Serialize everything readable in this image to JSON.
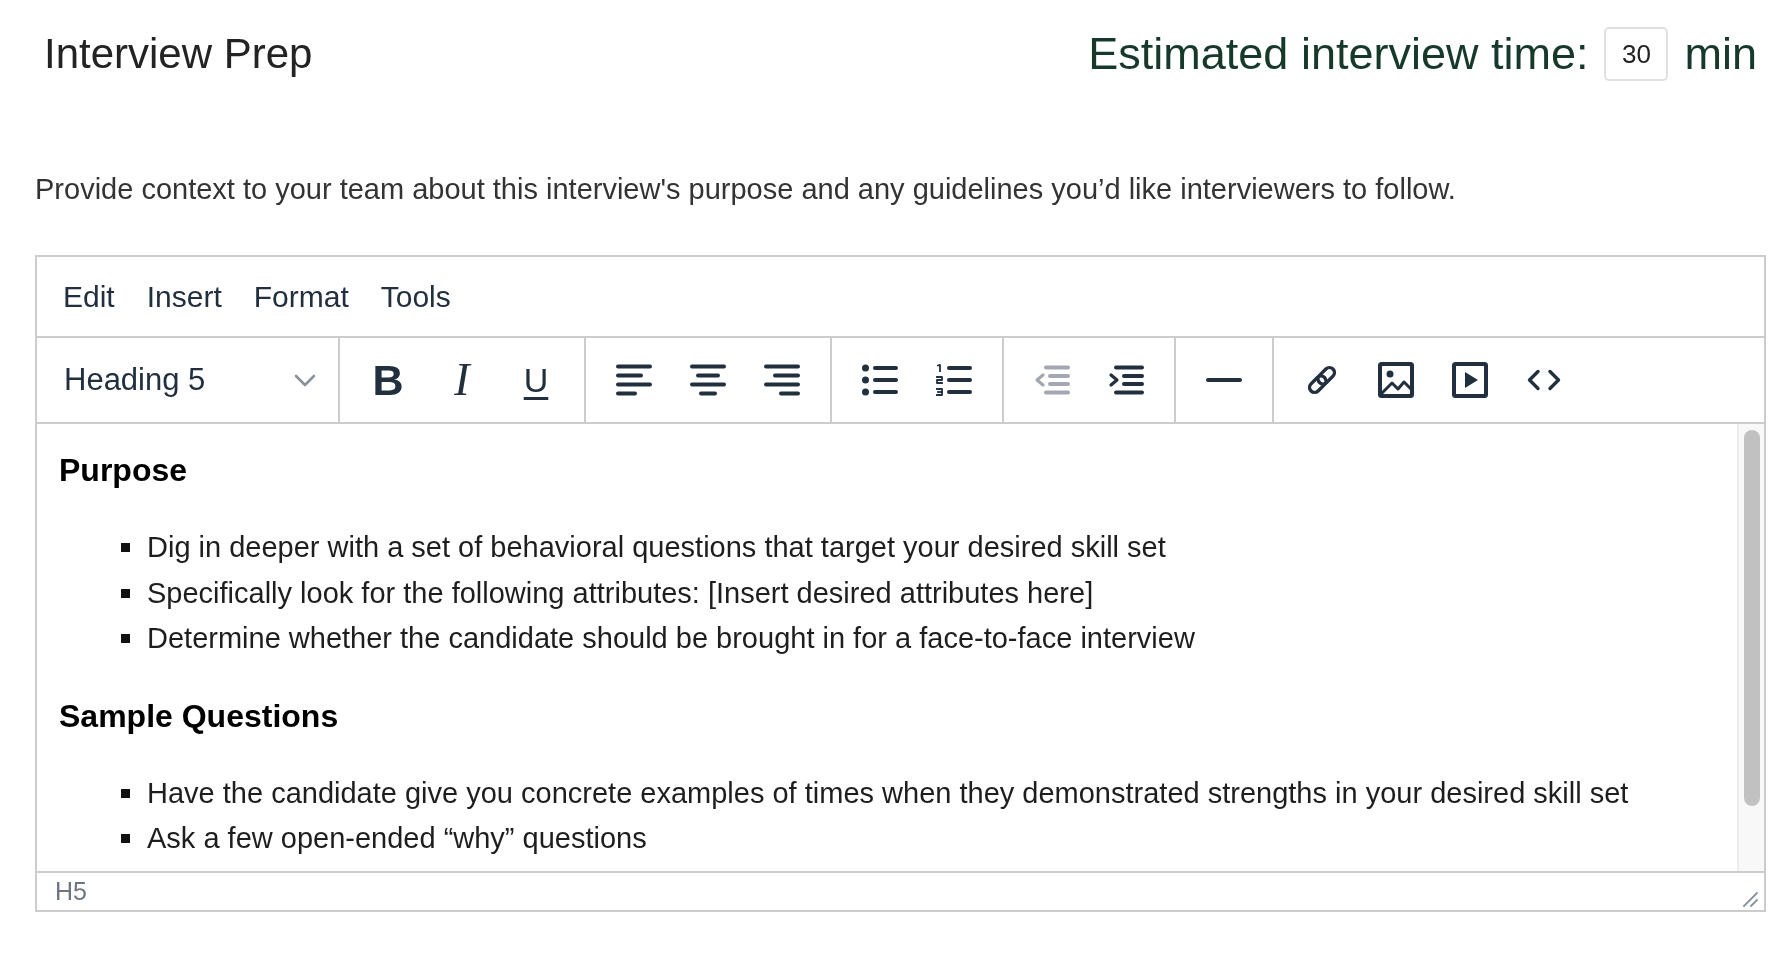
{
  "title": "Interview Prep",
  "estimated_time": {
    "label": "Estimated interview time:",
    "value": "30",
    "unit": "min"
  },
  "description": "Provide context to your team about this interview's purpose and any guidelines you’d like interviewers to follow.",
  "editor": {
    "menu_bar": [
      {
        "label": "Edit"
      },
      {
        "label": "Insert"
      },
      {
        "label": "Format"
      },
      {
        "label": "Tools"
      }
    ],
    "toolbar": {
      "block_format": "Heading 5",
      "groups": [
        [
          {
            "kind": "bold",
            "label": "B",
            "disabled": false
          },
          {
            "kind": "italic",
            "label": "I",
            "disabled": false
          },
          {
            "kind": "underline",
            "label": "U",
            "disabled": false
          }
        ],
        [
          {
            "kind": "align-left",
            "disabled": false
          },
          {
            "kind": "align-center",
            "disabled": false
          },
          {
            "kind": "align-right",
            "disabled": false
          }
        ],
        [
          {
            "kind": "bullet-list",
            "disabled": false
          },
          {
            "kind": "numbered-list",
            "disabled": false
          }
        ],
        [
          {
            "kind": "outdent",
            "disabled": true
          },
          {
            "kind": "indent",
            "disabled": false
          }
        ],
        [
          {
            "kind": "horizontal-line",
            "disabled": false
          }
        ],
        [
          {
            "kind": "link",
            "disabled": false
          },
          {
            "kind": "image",
            "disabled": false
          },
          {
            "kind": "media",
            "disabled": false
          },
          {
            "kind": "code",
            "disabled": false
          }
        ]
      ]
    },
    "content": [
      {
        "kind": "heading",
        "text": "Purpose"
      },
      {
        "kind": "list",
        "items": [
          "Dig in deeper with a set of behavioral questions that target your desired skill set",
          "Specifically look for the following attributes: [Insert desired attributes here]",
          "Determine whether the candidate should be brought in for a face-to-face interview"
        ]
      },
      {
        "kind": "heading",
        "text": "Sample Questions"
      },
      {
        "kind": "list",
        "items": [
          "Have the candidate give you concrete examples of times when they demonstrated strengths in your desired skill set",
          "Ask a few open-ended “why” questions"
        ]
      }
    ],
    "status_bar": {
      "path": "H5"
    }
  }
}
